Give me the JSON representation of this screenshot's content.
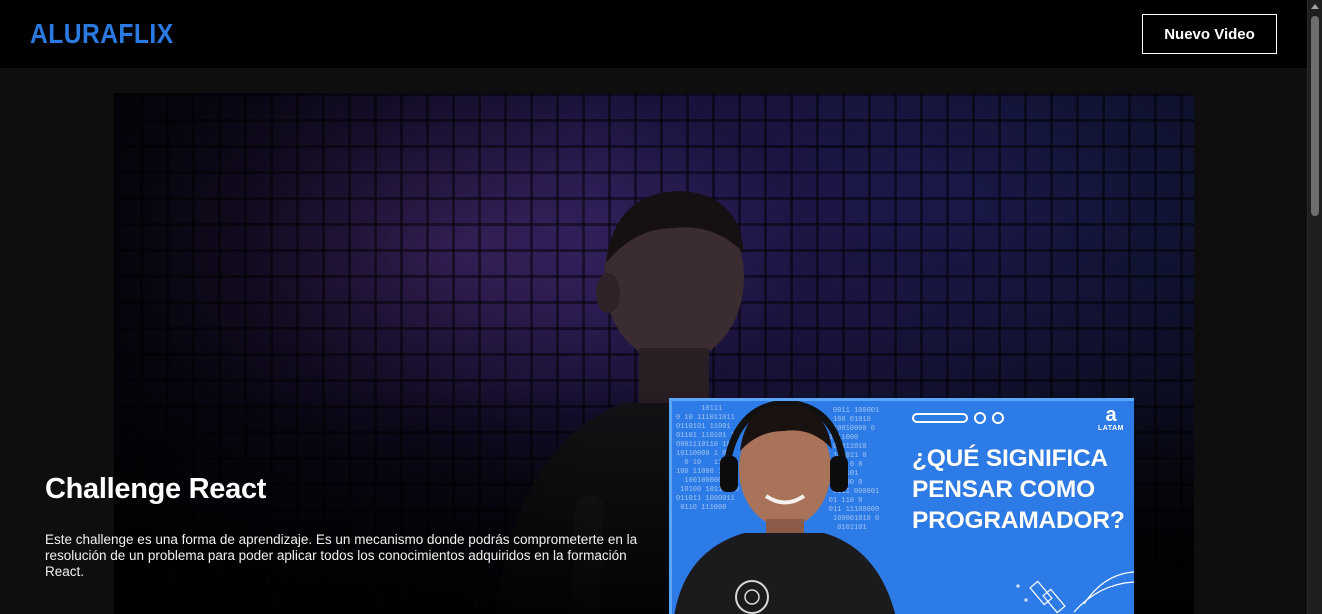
{
  "header": {
    "logo": "ALURAFLIX",
    "new_video_label": "Nuevo Video"
  },
  "banner": {
    "title": "Challenge React",
    "description": "Este challenge es una forma de aprendizaje. Es un mecanismo donde podrás comprometerte en la resolución de un problema para poder aplicar todos los conocimientos adquiridos en la formación React."
  },
  "video_card": {
    "title": "¿QUÉ SIGNIFICA PENSAR COMO PROGRAMADOR?",
    "brand_mark": "a",
    "brand_label": "LATAM",
    "binary_left": "      10111\n0 10 111011011  \n0110101 11001\n01101 110101 1\n0001110110 10\n10110000 1 01\n  0 10   110\n100 11000 110\n  1001000001101\n 10100 10111000\n011011 1000011\n 0110 111000",
    "binary_right": "     0011 100001\n     100 01010\n    110010000 0\n    1 11000\n     00011010\n     100011 0\n    0011 0 0\n   10001101\n    10 000 0\n     0011 000001\n    01 110 0\n    011 11100000\n     100001010 0\n      0101101"
  },
  "colors": {
    "brand": "#2a7ae2",
    "card_bg": "#2d7be6"
  }
}
